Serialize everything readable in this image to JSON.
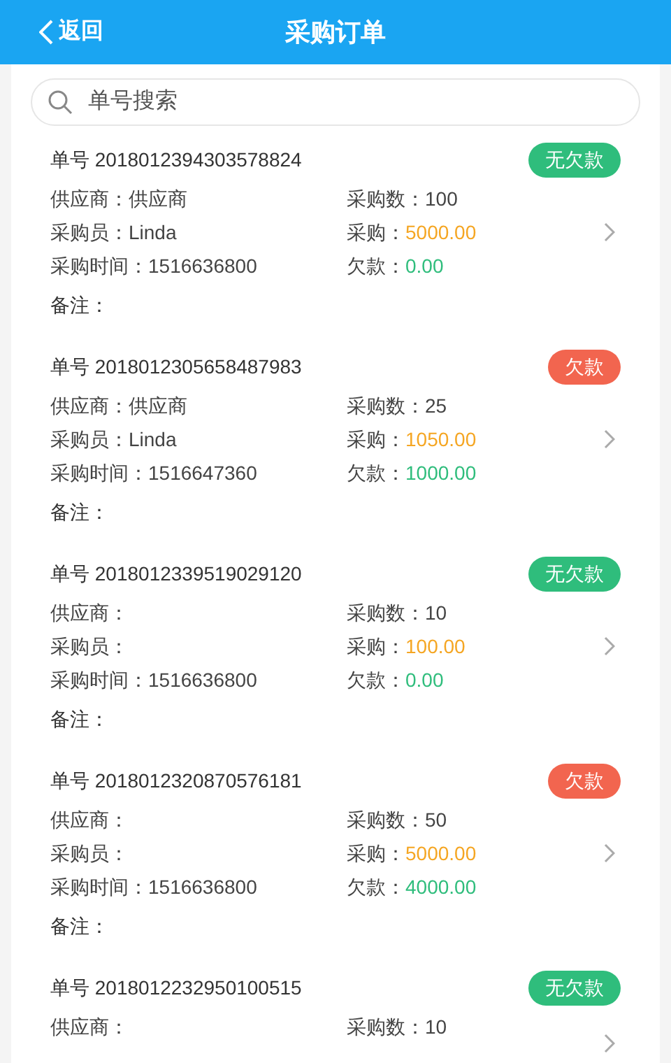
{
  "header": {
    "back": "返回",
    "title": "采购订单"
  },
  "search": {
    "placeholder": "单号搜索"
  },
  "orders": [
    {
      "number": "单号 2018012394303578824",
      "badge": {
        "text": "无欠款",
        "kind": "clear"
      },
      "supplier": {
        "label": "供应商：",
        "value": "供应商"
      },
      "buyer": {
        "label": "采购员：",
        "value": "Linda"
      },
      "time": {
        "label": "采购时间：",
        "value": "1516636800"
      },
      "count": {
        "label": "采购数：",
        "value": "100"
      },
      "amount": {
        "label": "采购：",
        "value": "5000.00"
      },
      "debt": {
        "label": "欠款：",
        "value": "0.00"
      },
      "remark": "备注："
    },
    {
      "number": "单号 2018012305658487983",
      "badge": {
        "text": "欠款",
        "kind": "owing"
      },
      "supplier": {
        "label": "供应商：",
        "value": "供应商"
      },
      "buyer": {
        "label": "采购员：",
        "value": "Linda"
      },
      "time": {
        "label": "采购时间：",
        "value": "1516647360"
      },
      "count": {
        "label": "采购数：",
        "value": "25"
      },
      "amount": {
        "label": "采购：",
        "value": "1050.00"
      },
      "debt": {
        "label": "欠款：",
        "value": "1000.00"
      },
      "remark": "备注："
    },
    {
      "number": "单号 2018012339519029120",
      "badge": {
        "text": "无欠款",
        "kind": "clear"
      },
      "supplier": {
        "label": "供应商："
      },
      "buyer": {
        "label": "采购员："
      },
      "time": {
        "label": "采购时间：",
        "value": "1516636800"
      },
      "count": {
        "label": "采购数：",
        "value": "10"
      },
      "amount": {
        "label": "采购：",
        "value": "100.00"
      },
      "debt": {
        "label": "欠款：",
        "value": "0.00"
      },
      "remark": "备注："
    },
    {
      "number": "单号 2018012320870576181",
      "badge": {
        "text": "欠款",
        "kind": "owing"
      },
      "supplier": {
        "label": "供应商："
      },
      "buyer": {
        "label": "采购员："
      },
      "time": {
        "label": "采购时间：",
        "value": "1516636800"
      },
      "count": {
        "label": "采购数：",
        "value": "50"
      },
      "amount": {
        "label": "采购：",
        "value": "5000.00"
      },
      "debt": {
        "label": "欠款：",
        "value": "4000.00"
      },
      "remark": "备注："
    },
    {
      "number": "单号 2018012232950100515",
      "badge": {
        "text": "无欠款",
        "kind": "clear"
      },
      "supplier": {
        "label": "供应商："
      },
      "count": {
        "label": "采购数：",
        "value": "10"
      }
    }
  ]
}
